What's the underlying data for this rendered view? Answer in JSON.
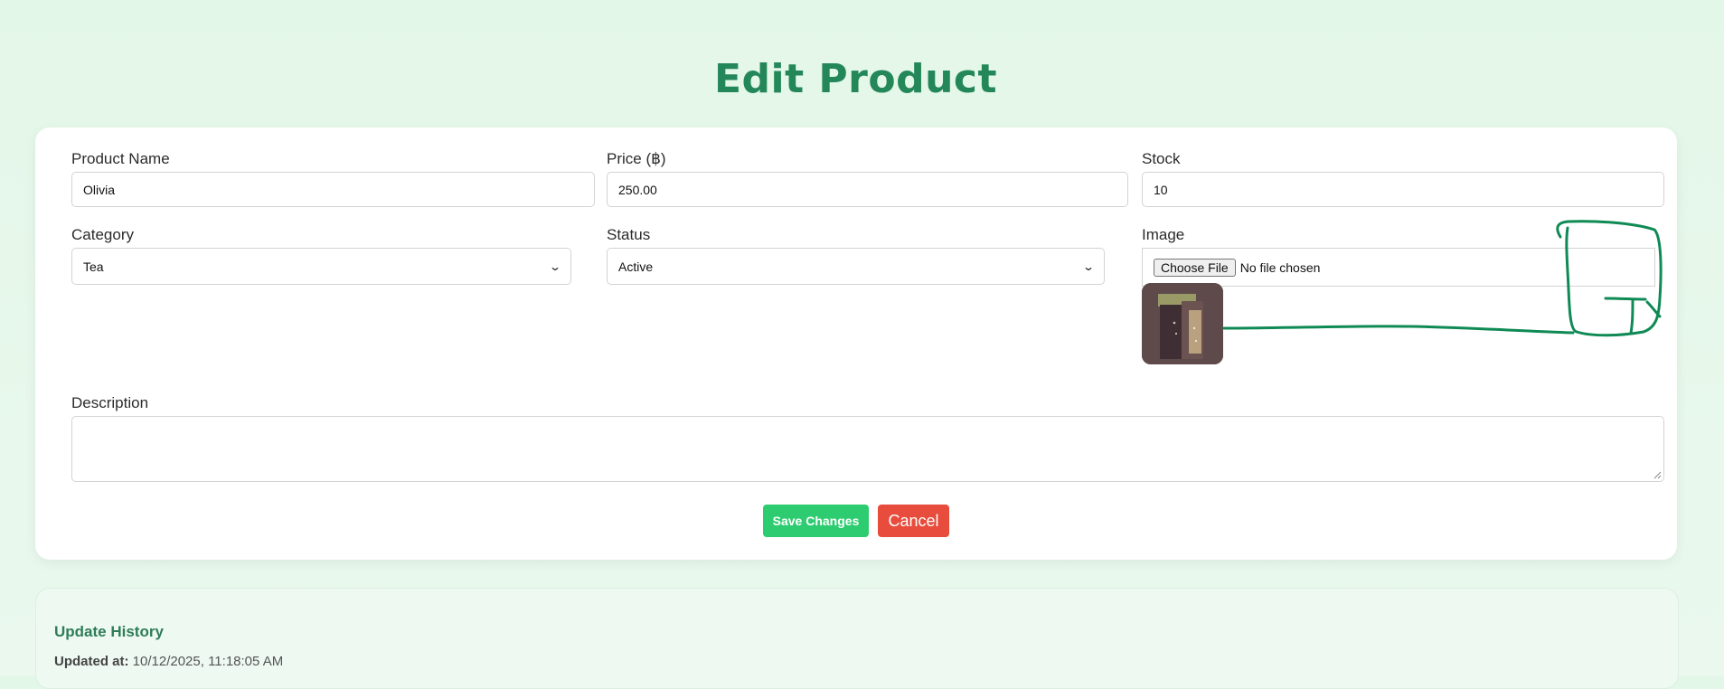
{
  "page": {
    "title": "Edit Product"
  },
  "form": {
    "product_name": {
      "label": "Product Name",
      "value": "Olivia",
      "placeholder": ""
    },
    "price": {
      "label": "Price (฿)",
      "value": "250.00",
      "placeholder": ""
    },
    "stock": {
      "label": "Stock",
      "value": "10",
      "placeholder": ""
    },
    "category": {
      "label": "Category",
      "selected": "Tea"
    },
    "status": {
      "label": "Status",
      "selected": "Active"
    },
    "image": {
      "label": "Image",
      "choose_button": "Choose File",
      "file_status": "No file chosen",
      "thumbnail_icon": "product-bag-image"
    },
    "description": {
      "label": "Description",
      "value": ""
    }
  },
  "actions": {
    "save_label": "Save Changes",
    "cancel_label": "Cancel"
  },
  "history": {
    "title": "Update History",
    "updated_label": "Updated at:",
    "updated_value": "10/12/2025, 11:18:05 AM"
  },
  "colors": {
    "accent": "#23875a",
    "save": "#2ecc71",
    "cancel": "#e74c3c",
    "annotation": "#0f8a55"
  }
}
